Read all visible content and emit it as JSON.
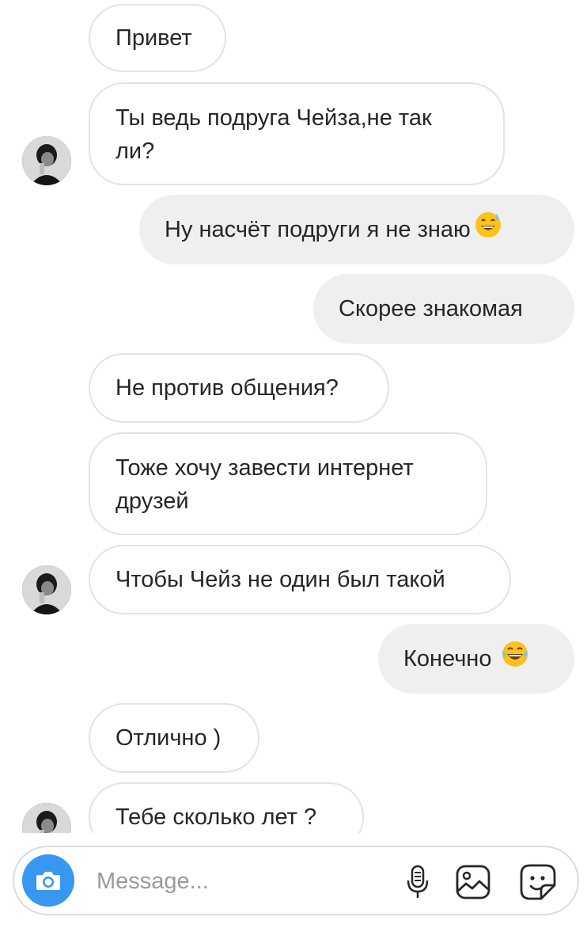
{
  "messages": [
    {
      "side": "in",
      "text": "Привет"
    },
    {
      "side": "in",
      "line1": "Ты ведь подруга Чейза,не так",
      "line2": "ли?"
    },
    {
      "side": "out",
      "text": "Ну насчёт подруги я не знаю",
      "emoji": "grinning-sweat-emoji"
    },
    {
      "side": "out",
      "text": "Скорее знакомая"
    },
    {
      "side": "in",
      "text": "Не против общения?"
    },
    {
      "side": "in",
      "line1": "Тоже хочу завести интернет",
      "line2": "друзей"
    },
    {
      "side": "in",
      "text": "Чтобы Чейз не один был такой"
    },
    {
      "side": "out",
      "text": "Конечно",
      "emoji": "tears-of-joy-emoji"
    },
    {
      "side": "in",
      "text": "Отлично )"
    },
    {
      "side": "in",
      "text": "Тебе сколько лет ?"
    }
  ],
  "composer": {
    "placeholder": "Message...",
    "icons": [
      "camera-icon",
      "microphone-icon",
      "gallery-icon",
      "sticker-icon"
    ]
  },
  "colors": {
    "incoming_border": "#e3e3e3",
    "outgoing_bg": "#efefef",
    "camera_bg": "#3897f0",
    "text": "#262626"
  }
}
